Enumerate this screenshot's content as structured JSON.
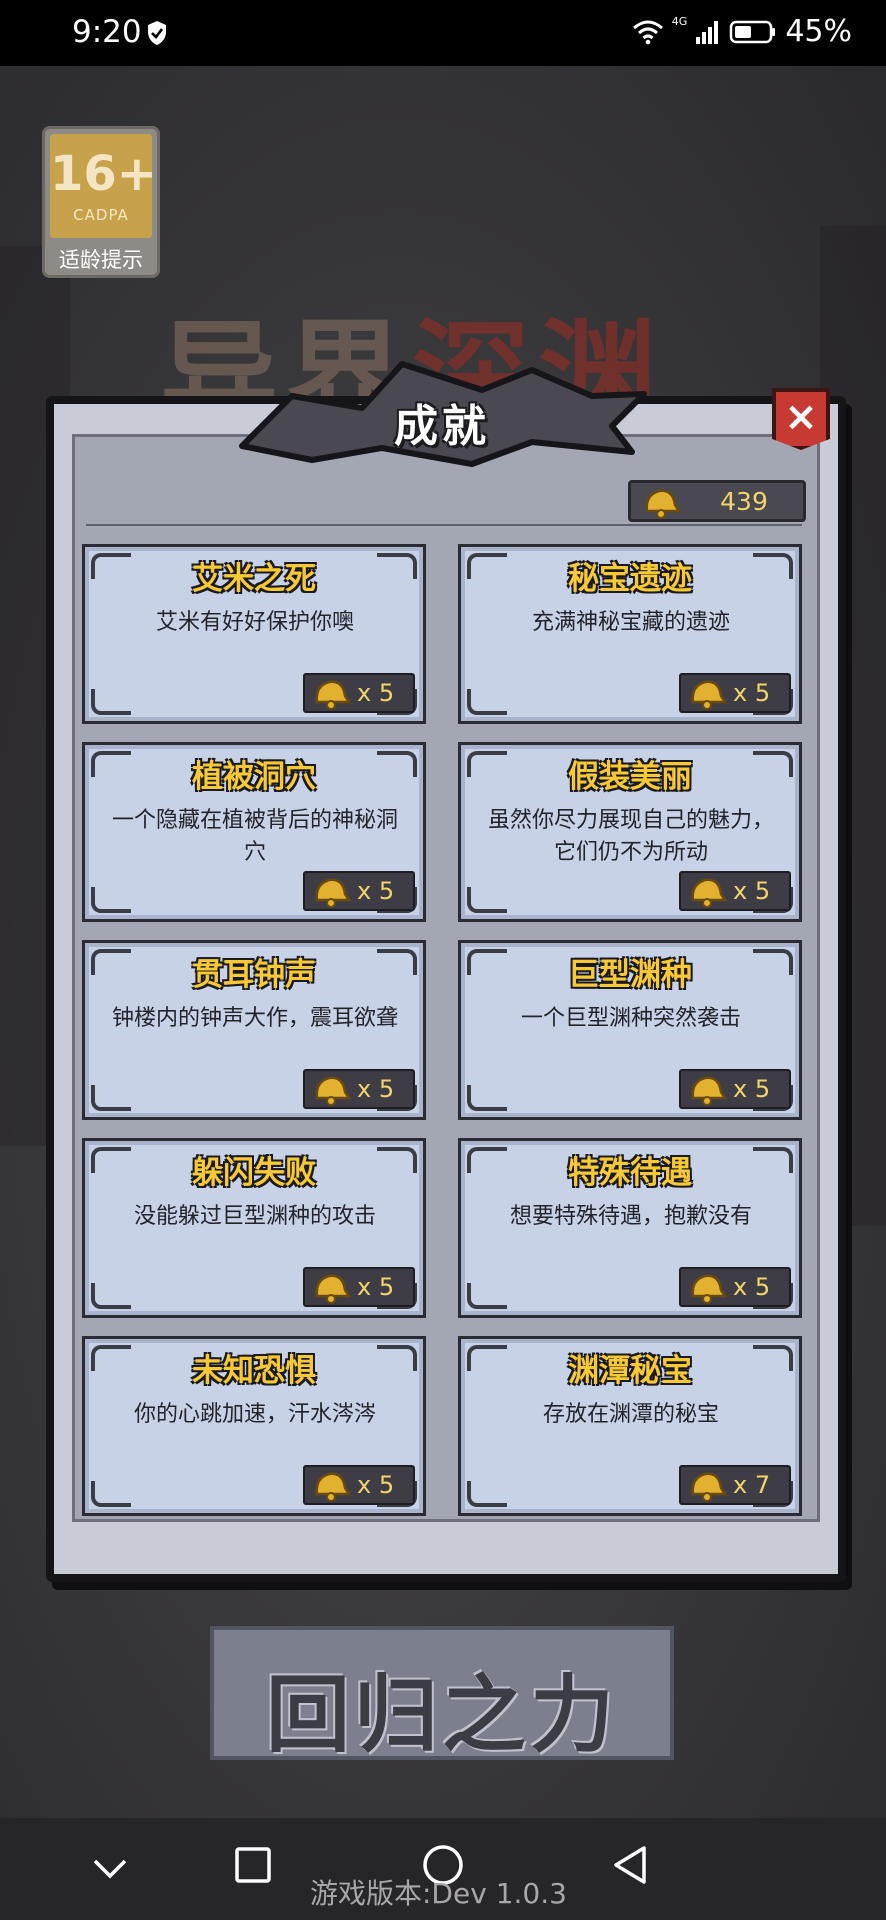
{
  "status_bar": {
    "time": "9:20",
    "network": "4G",
    "battery": "45%"
  },
  "background": {
    "age_rating": "16+",
    "age_org": "CADPA",
    "age_tip": "适龄提示",
    "game_title_left": "异界",
    "game_title_right": "深渊",
    "bottom_button": "回归之力"
  },
  "dialog": {
    "title": "成就",
    "close_label": "×",
    "score": "439",
    "achievements": [
      {
        "title": "艾米之死",
        "desc": "艾米有好好保护你噢",
        "reward": "x 5"
      },
      {
        "title": "秘宝遗迹",
        "desc": "充满神秘宝藏的遗迹",
        "reward": "x 5"
      },
      {
        "title": "植被洞穴",
        "desc": "一个隐藏在植被背后的神秘洞穴",
        "reward": "x 5"
      },
      {
        "title": "假装美丽",
        "desc": "虽然你尽力展现自己的魅力，它们仍不为所动",
        "reward": "x 5"
      },
      {
        "title": "贯耳钟声",
        "desc": "钟楼内的钟声大作，震耳欲聋",
        "reward": "x 5"
      },
      {
        "title": "巨型渊种",
        "desc": "一个巨型渊种突然袭击",
        "reward": "x 5"
      },
      {
        "title": "躲闪失败",
        "desc": "没能躲过巨型渊种的攻击",
        "reward": "x 5"
      },
      {
        "title": "特殊待遇",
        "desc": "想要特殊待遇，抱歉没有",
        "reward": "x 5"
      },
      {
        "title": "未知恐惧",
        "desc": "你的心跳加速，汗水涔涔",
        "reward": "x 5"
      },
      {
        "title": "渊潭秘宝",
        "desc": "存放在渊潭的秘宝",
        "reward": "x 7"
      }
    ]
  },
  "version": "游戏版本:Dev 1.0.3",
  "colors": {
    "title_gold": "#f7c934",
    "card_bg": "#c8d2e6",
    "close_red": "#c73a33"
  }
}
